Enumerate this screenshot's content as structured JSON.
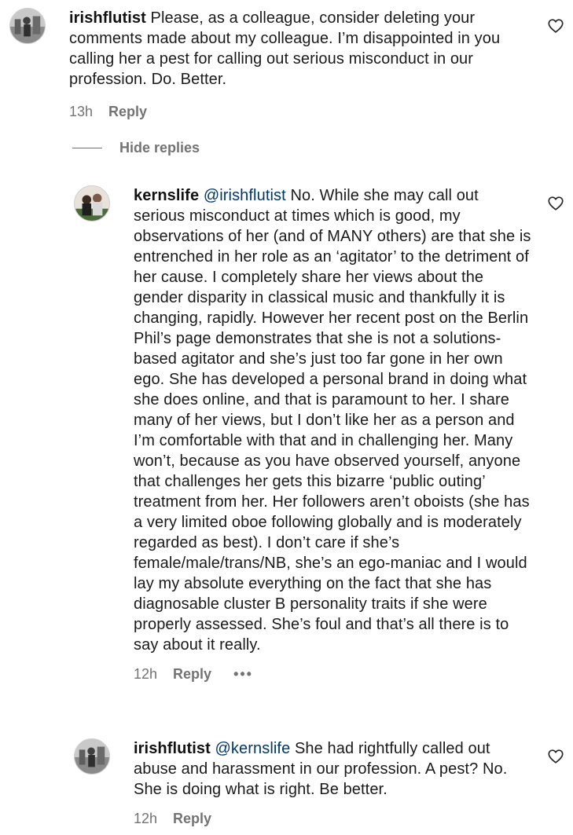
{
  "comments": [
    {
      "username": "irishflutist",
      "mention": "",
      "text": " Please, as a colleague, consider deleting your comments made about my colleague. I’m disappointed in you calling her a pest for calling out serious misconduct in our profession. Do. Better.",
      "time": "13h",
      "reply_label": "Reply"
    },
    {
      "username": "kernslife",
      "mention": " @irishflutist",
      "text": " No. While she may call out serious misconduct at times which is good, my observations of her (and of MANY others) are that she is entrenched in her role as an ‘agitator’ to the detriment of her cause. I completely share her views about the gender disparity in classical music and thankfully it is changing, rapidly. However her recent post on the Berlin Phil’s page demonstrates that she is not a solutions-based agitator and she’s just too far gone in her own ego. She has developed a personal brand in doing what she does online, and that is paramount to her. I share many of her views, but I don’t like her as a person and I’m comfortable with that and in challenging her. Many won’t, because as you have observed yourself, anyone that challenges her gets this bizarre ‘public outing’ treatment from her. Her followers aren’t oboists (she has a very limited oboe following globally and is moderately regarded as best). I don’t care if she’s female/male/trans/NB, she’s an ego-maniac and I would lay my absolute everything on the fact that she has diagnosable cluster B personality traits if she were properly assessed. She’s foul and that’s all there is to say about it really.",
      "time": "12h",
      "reply_label": "Reply",
      "more_label": "•••"
    },
    {
      "username": "irishflutist",
      "mention": " @kernslife",
      "text": " She had rightfully called out abuse and harassment in our profession. A pest? No. She is doing what is right. Be better.",
      "time": "12h",
      "reply_label": "Reply"
    }
  ],
  "thread": {
    "hide_replies_label": "Hide replies"
  },
  "icons": {
    "like": "heart-icon",
    "avatar_irishflutist": "avatar",
    "avatar_kernslife": "avatar"
  },
  "colors": {
    "text": "#1a1a1a",
    "muted": "#737373",
    "mention": "#00376b",
    "background": "#ffffff"
  }
}
